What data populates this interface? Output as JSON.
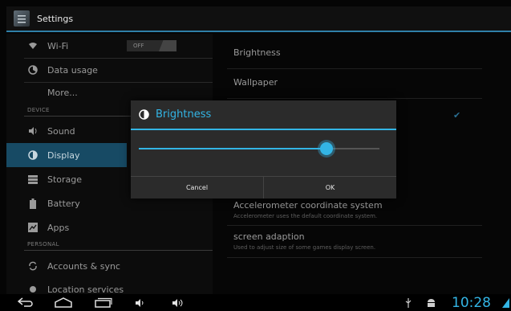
{
  "app": {
    "title": "Settings"
  },
  "sidebar": {
    "wifi": {
      "label": "Wi-Fi",
      "toggle": "OFF"
    },
    "data_usage": "Data usage",
    "more": "More...",
    "header_device": "DEVICE",
    "sound": "Sound",
    "display": "Display",
    "storage": "Storage",
    "battery": "Battery",
    "apps": "Apps",
    "header_personal": "PERSONAL",
    "accounts": "Accounts & sync",
    "location": "Location services"
  },
  "content": {
    "brightness": "Brightness",
    "wallpaper": "Wallpaper",
    "accel_title": "Accelerometer coordinate system",
    "accel_sub": "Accelerometer uses the default coordinate system.",
    "screen_title": "screen adaption",
    "screen_sub": "Used to adjust size of some games display screen."
  },
  "dialog": {
    "title": "Brightness",
    "slider_value": 0.78,
    "cancel": "Cancel",
    "ok": "OK"
  },
  "statusbar": {
    "time": "10:28"
  },
  "colors": {
    "accent": "#33b5e5",
    "selected": "#174a64"
  }
}
